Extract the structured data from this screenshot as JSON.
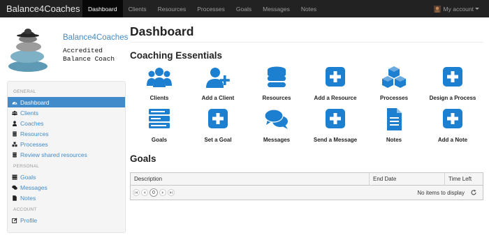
{
  "navbar": {
    "brand": "Balance4Coaches",
    "items": [
      {
        "label": "Dashboard",
        "active": true
      },
      {
        "label": "Clients"
      },
      {
        "label": "Resources"
      },
      {
        "label": "Processes"
      },
      {
        "label": "Goals"
      },
      {
        "label": "Messages"
      },
      {
        "label": "Notes"
      }
    ],
    "account_label": "My account"
  },
  "logo": {
    "name": "Balance4Coaches",
    "subtitle_line1": "Accredited",
    "subtitle_line2": "Balance Coach"
  },
  "sidebar": {
    "sections": [
      {
        "header": "GENERAL",
        "items": [
          {
            "label": "Dashboard",
            "icon": "dashboard-icon",
            "active": true
          },
          {
            "label": "Clients",
            "icon": "users-icon"
          },
          {
            "label": "Coaches",
            "icon": "user-icon"
          },
          {
            "label": "Resources",
            "icon": "database-icon"
          },
          {
            "label": "Processes",
            "icon": "cubes-icon"
          },
          {
            "label": "Review shared resources",
            "icon": "database-icon"
          }
        ]
      },
      {
        "header": "PERSONAL",
        "items": [
          {
            "label": "Goals",
            "icon": "tasks-icon"
          },
          {
            "label": "Messages",
            "icon": "comments-icon"
          },
          {
            "label": "Notes",
            "icon": "file-icon"
          }
        ]
      },
      {
        "header": "ACCOUNT",
        "items": [
          {
            "label": "Profile",
            "icon": "edit-icon"
          }
        ]
      }
    ]
  },
  "main": {
    "title": "Dashboard",
    "essentials_title": "Coaching Essentials",
    "tiles": [
      {
        "label": "Clients",
        "icon": "users-icon"
      },
      {
        "label": "Add a Client",
        "icon": "user-plus-icon"
      },
      {
        "label": "Resources",
        "icon": "database-icon"
      },
      {
        "label": "Add a Resource",
        "icon": "plus-square-icon"
      },
      {
        "label": "Processes",
        "icon": "cubes-icon"
      },
      {
        "label": "Design a Process",
        "icon": "plus-square-icon"
      },
      {
        "label": "Goals",
        "icon": "tasks-icon"
      },
      {
        "label": "Set a Goal",
        "icon": "plus-square-icon"
      },
      {
        "label": "Messages",
        "icon": "comments-icon"
      },
      {
        "label": "Send a Message",
        "icon": "plus-square-icon"
      },
      {
        "label": "Notes",
        "icon": "file-text-icon"
      },
      {
        "label": "Add a Note",
        "icon": "plus-square-icon"
      }
    ],
    "goals_title": "Goals",
    "grid": {
      "columns": [
        "Description",
        "End Date",
        "Time Left"
      ],
      "page_number": "0",
      "empty_message": "No items to display"
    }
  },
  "colors": {
    "accent": "#428bca",
    "navbar_bg": "#222222",
    "icon_blue": "#1c7fd0"
  }
}
